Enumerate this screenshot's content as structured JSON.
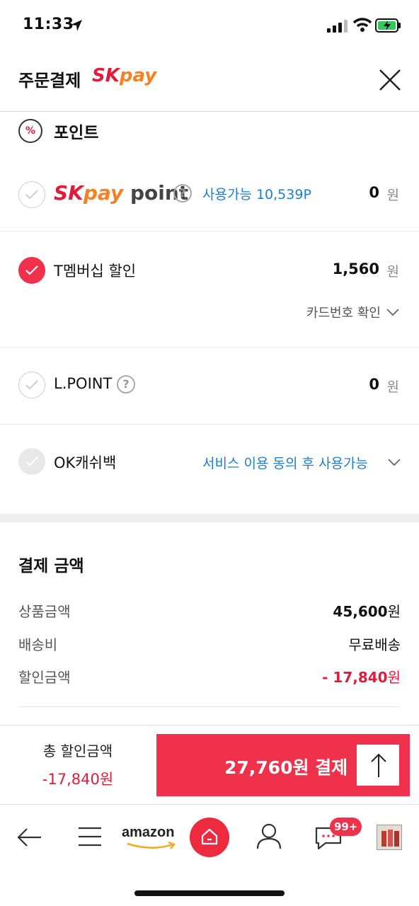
{
  "status_bar": {
    "time": "11:33"
  },
  "header": {
    "title": "주문결제",
    "logo_sk": "SK",
    "logo_pay": "pay"
  },
  "points_section": {
    "title": "포인트",
    "icon": "%",
    "items": [
      {
        "label_sk": "SK",
        "label_pay": "pay",
        "label_point": "point",
        "available": "사용가능 10,539P",
        "amount": "0",
        "unit": "원",
        "checked": false
      },
      {
        "label": "T멤버십 할인",
        "amount": "1,560",
        "unit": "원",
        "checked": true,
        "sub_link": "카드번호 확인"
      },
      {
        "label": "L.POINT",
        "amount": "0",
        "unit": "원",
        "checked": false
      },
      {
        "label": "OK캐쉬백",
        "available": "서비스 이용 동의 후 사용가능",
        "checked": false,
        "disabled": true
      }
    ]
  },
  "payment_summary": {
    "title": "결제 금액",
    "rows": [
      {
        "label": "상품금액",
        "value": "45,600",
        "unit": "원"
      },
      {
        "label": "배송비",
        "value": "무료배송"
      },
      {
        "label": "할인금액",
        "value": "- 17,840",
        "unit": "원"
      }
    ]
  },
  "pay_bar": {
    "total_discount_label": "총 할인금액",
    "total_discount_value": "-17,840원",
    "pay_button_label": "27,760원 결제"
  },
  "bottom_nav": {
    "brand": "amazon",
    "chat_badge": "99+"
  },
  "colors": {
    "accent": "#f0314c",
    "link_blue": "#1a7fd1",
    "sk_red": "#e31b3b",
    "pay_orange": "#f5811f"
  }
}
